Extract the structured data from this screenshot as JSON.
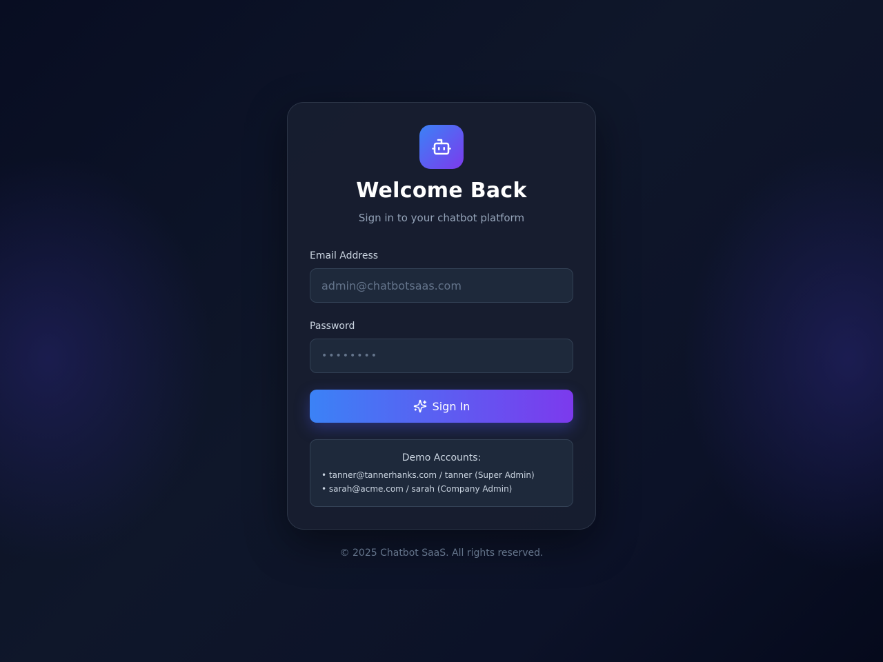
{
  "card": {
    "logo_icon": "robot-icon",
    "title": "Welcome Back",
    "subtitle": "Sign in to your chatbot platform"
  },
  "form": {
    "email_label": "Email Address",
    "email_placeholder": "admin@chatbotsaas.com",
    "password_label": "Password",
    "password_placeholder": "••••••••",
    "signin_icon": "sparkles-icon",
    "signin_label": "Sign In"
  },
  "demo": {
    "title": "Demo Accounts:",
    "accounts": [
      "• tanner@tannerhanks.com / tanner (Super Admin)",
      "• sarah@acme.com / sarah (Company Admin)"
    ]
  },
  "footer": {
    "copyright": "© 2025 Chatbot SaaS. All rights reserved."
  },
  "colors": {
    "accent_start": "#3b82f6",
    "accent_end": "#7c3aed",
    "card_bg": "#181e30",
    "input_bg": "#1e293b"
  }
}
